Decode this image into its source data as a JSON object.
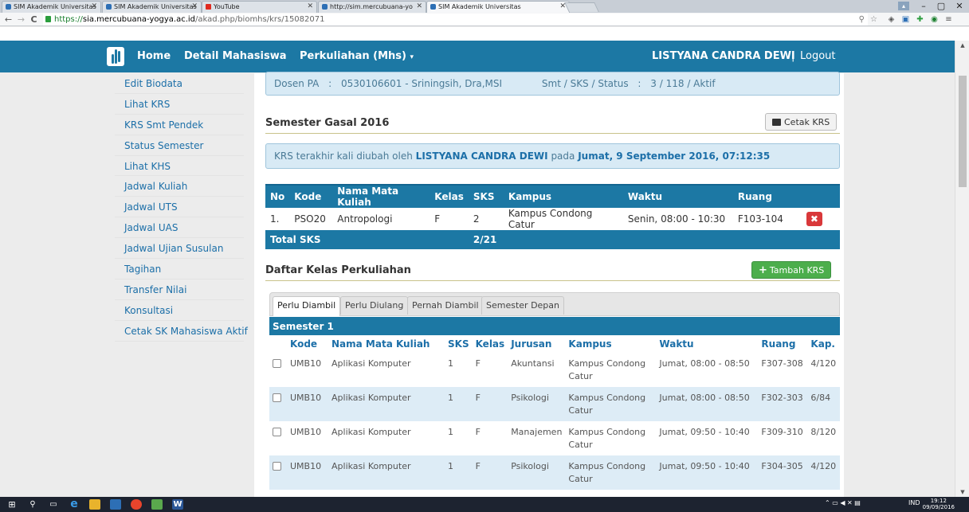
{
  "browser": {
    "tabs": [
      {
        "label": "SIM Akademik Universitas",
        "active": false
      },
      {
        "label": "SIM Akademik Universitas",
        "active": false
      },
      {
        "label": "YouTube",
        "active": false
      },
      {
        "label": "http://sim.mercubuana-yo",
        "active": false
      },
      {
        "label": "SIM Akademik Universitas",
        "active": true
      }
    ],
    "url_scheme": "https://",
    "url_host": "sia.mercubuana-yogya.ac.id",
    "url_path": "/akad.php/biomhs/krs/15082071"
  },
  "navbar": {
    "home": "Home",
    "detail": "Detail Mahasiswa",
    "perkuliahan": "Perkuliahan (Mhs)",
    "caret": "▾",
    "user": "LISTYANA CANDRA DEWI",
    "separator": "|",
    "logout": "Logout"
  },
  "sidebar": {
    "items": [
      "Edit Biodata",
      "Lihat KRS",
      "KRS Smt Pendek",
      "Status Semester",
      "Lihat KHS",
      "Jadwal Kuliah",
      "Jadwal UTS",
      "Jadwal UAS",
      "Jadwal Ujian Susulan",
      "Tagihan",
      "Transfer Nilai",
      "Konsultasi",
      "Cetak SK Mahasiswa Aktif"
    ]
  },
  "info": {
    "dosen_label": "Dosen PA",
    "colon": ":",
    "dosen_value": "0530106601 - Sriningsih, Dra,MSI",
    "smt_label": "Smt / SKS / Status",
    "smt_value": "3 / 118 / Aktif"
  },
  "semester": {
    "title": "Semester Gasal 2016",
    "print_button": "Cetak KRS"
  },
  "changed": {
    "prefix": "KRS terakhir kali diubah oleh",
    "user": "LISTYANA CANDRA DEWI",
    "mid": "pada",
    "datetime": "Jumat, 9 September 2016, 07:12:35"
  },
  "krs_table": {
    "headers": [
      "No",
      "Kode",
      "Nama Mata Kuliah",
      "Kelas",
      "SKS",
      "Kampus",
      "Waktu",
      "Ruang"
    ],
    "rows": [
      [
        "1.",
        "PSO20",
        "Antropologi",
        "F",
        "2",
        "Kampus Condong Catur",
        "Senin, 08:00 - 10:30",
        "F103-104"
      ]
    ],
    "delete_icon": "✖",
    "total_label": "Total SKS",
    "total_value": "2/21"
  },
  "daftar": {
    "title": "Daftar Kelas Perkuliahan",
    "add_button": "Tambah KRS",
    "tabs": [
      "Perlu Diambil",
      "Perlu Diulang",
      "Pernah Diambil",
      "Semester Depan"
    ],
    "group": "Semester 1",
    "headers": [
      "Kode",
      "Nama Mata Kuliah",
      "SKS",
      "Kelas",
      "Jurusan",
      "Kampus",
      "Waktu",
      "Ruang",
      "Kap."
    ],
    "rows": [
      [
        "UMB10",
        "Aplikasi Komputer",
        "1",
        "F",
        "Akuntansi",
        "Kampus Condong Catur",
        "Jumat, 08:00 - 08:50",
        "F307-308",
        "4/120"
      ],
      [
        "UMB10",
        "Aplikasi Komputer",
        "1",
        "F",
        "Psikologi",
        "Kampus Condong Catur",
        "Jumat, 08:00 - 08:50",
        "F302-303",
        "6/84"
      ],
      [
        "UMB10",
        "Aplikasi Komputer",
        "1",
        "F",
        "Manajemen",
        "Kampus Condong Catur",
        "Jumat, 09:50 - 10:40",
        "F309-310",
        "8/120"
      ],
      [
        "UMB10",
        "Aplikasi Komputer",
        "1",
        "F",
        "Psikologi",
        "Kampus Condong Catur",
        "Jumat, 09:50 - 10:40",
        "F304-305",
        "4/120"
      ]
    ]
  },
  "taskbar": {
    "lang": "IND",
    "time": "19:12",
    "date": "09/09/2016"
  },
  "colors": {
    "primary": "#1c78a4",
    "success": "#4cae4c",
    "danger": "#d9383a",
    "info_bg": "#d8eaf5"
  }
}
